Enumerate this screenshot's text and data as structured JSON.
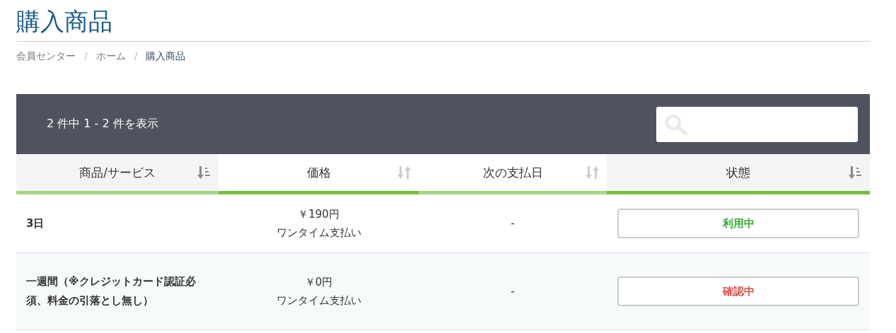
{
  "title": "購入商品",
  "breadcrumb": [
    {
      "label": "会員センター",
      "current": false
    },
    {
      "label": "ホーム",
      "current": false
    },
    {
      "label": "購入商品",
      "current": true
    }
  ],
  "breadcrumb_separator": "/",
  "table": {
    "summary": "2 件中 1 - 2 件を表示",
    "columns": [
      {
        "label": "商品/サービス",
        "sorted": true
      },
      {
        "label": "価格",
        "sorted": false
      },
      {
        "label": "次の支払日",
        "sorted": false
      },
      {
        "label": "状態",
        "sorted": true
      }
    ],
    "rows": [
      {
        "product": "3日",
        "price": "￥190円",
        "payment": "ワンタイム支払い",
        "next_date": "-",
        "status": "利用中",
        "color": "#3aaa35"
      },
      {
        "product": "一週間（※クレジットカード認証必須、料金の引落とし無し）",
        "price": "￥0円",
        "payment": "ワンタイム支払い",
        "next_date": "-",
        "status": "確認中",
        "color": "#d9534f"
      }
    ]
  }
}
